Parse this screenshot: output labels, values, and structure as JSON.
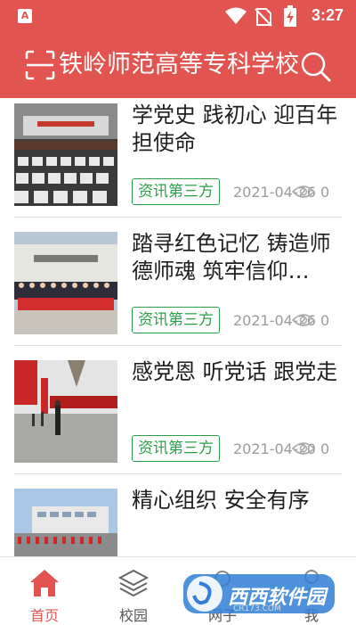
{
  "status_bar": {
    "time": "3:27",
    "app_badge": "A"
  },
  "header": {
    "title": "铁岭师范高等专科学校"
  },
  "articles": [
    {
      "title": "学党史 践初心 迎百年 担使命",
      "tag": "资讯第三方",
      "date": "2021-04-26",
      "views": "0"
    },
    {
      "title": "踏寻红色记忆 铸造师德师魂 筑牢信仰…",
      "tag": "资讯第三方",
      "date": "2021-04-26",
      "views": "0"
    },
    {
      "title": "感党恩 听党话 跟党走",
      "tag": "资讯第三方",
      "date": "2021-04-20",
      "views": "0"
    },
    {
      "title": "精心组织 安全有序",
      "tag": "",
      "date": "",
      "views": ""
    }
  ],
  "tabs": [
    {
      "label": "首页"
    },
    {
      "label": "校园"
    },
    {
      "label": "网子"
    },
    {
      "label": "我"
    }
  ],
  "watermark": {
    "text": "西西软件园",
    "sub": "CR173.COM"
  },
  "colors": {
    "brand": "#e25450",
    "tag_green": "#2aa04a",
    "meta_gray": "#9a9a9a"
  }
}
